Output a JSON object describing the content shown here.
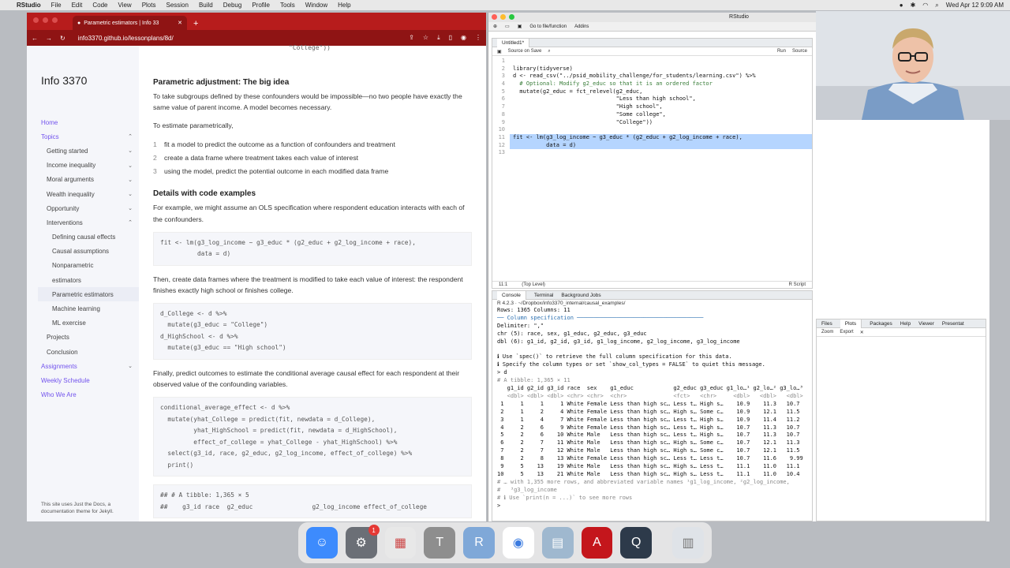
{
  "menubar": {
    "app_name": "RStudio",
    "items": [
      "File",
      "Edit",
      "Code",
      "View",
      "Plots",
      "Session",
      "Build",
      "Debug",
      "Profile",
      "Tools",
      "Window",
      "Help"
    ],
    "clock": "Wed Apr 12  9:09 AM"
  },
  "browser": {
    "tab_title": "Parametric estimators | Info 33",
    "url": "info3370.github.io/lessonplans/8d/",
    "site_title": "Info 3370",
    "nav": [
      {
        "label": "Home",
        "level": 0,
        "link": true
      },
      {
        "label": "Topics",
        "level": 0,
        "link": true,
        "chevron": "⌃"
      },
      {
        "label": "Getting started",
        "level": 1,
        "chevron": "⌄"
      },
      {
        "label": "Income inequality",
        "level": 1,
        "chevron": "⌄"
      },
      {
        "label": "Moral arguments",
        "level": 1,
        "chevron": "⌄"
      },
      {
        "label": "Wealth inequality",
        "level": 1,
        "chevron": "⌄"
      },
      {
        "label": "Opportunity",
        "level": 1,
        "chevron": "⌄"
      },
      {
        "label": "Interventions",
        "level": 1,
        "chevron": "⌃"
      },
      {
        "label": "Defining causal effects",
        "level": 2
      },
      {
        "label": "Causal assumptions",
        "level": 2
      },
      {
        "label": "Nonparametric",
        "level": 2
      },
      {
        "label": "estimators",
        "level": 2
      },
      {
        "label": "Parametric estimators",
        "level": 2,
        "active": true
      },
      {
        "label": "Machine learning",
        "level": 2
      },
      {
        "label": "ML exercise",
        "level": 2
      },
      {
        "label": "Projects",
        "level": 1
      },
      {
        "label": "Conclusion",
        "level": 1
      },
      {
        "label": "Assignments",
        "level": 0,
        "link": true,
        "chevron": "⌄"
      },
      {
        "label": "Weekly Schedule",
        "level": 0,
        "link": true
      },
      {
        "label": "Who We Are",
        "level": 0,
        "link": true
      }
    ],
    "footer": "This site uses Just the Docs, a documentation theme for Jekyll.",
    "content": {
      "top_code": "\"College\"))",
      "h1": "Parametric adjustment: The big idea",
      "p1": "To take subgroups defined by these confounders would be impossible—no two people have exactly the same value of parent income. A model becomes necessary.",
      "p2": "To estimate parametrically,",
      "steps": [
        "fit a model to predict the outcome as a function of confounders and treatment",
        "create a data frame where treatment takes each value of interest",
        "using the model, predict the potential outcome in each modified data frame"
      ],
      "h2": "Details with code examples",
      "p3": "For example, we might assume an OLS specification where respondent education interacts with each of the confounders.",
      "code1": "fit <- lm(g3_log_income ~ g3_educ * (g2_educ + g2_log_income + race),\n          data = d)",
      "p4": "Then, create data frames where the treatment is modified to take each value of interest: the respondent finishes exactly high school or finishes college.",
      "code2": "d_College <- d %>%\n  mutate(g3_educ = \"College\")\nd_HighSchool <- d %>%\n  mutate(g3_educ == \"High school\")",
      "p5": "Finally, predict outcomes to estimate the conditional average causal effect for each respondent at their observed value of the confounding variables.",
      "code3": "conditional_average_effect <- d %>%\n  mutate(yhat_College = predict(fit, newdata = d_College),\n         yhat_HighSchool = predict(fit, newdata = d_HighSchool),\n         effect_of_college = yhat_College - yhat_HighSchool) %>%\n  select(g3_id, race, g2_educ, g2_log_income, effect_of_college) %>%\n  print()",
      "code4": "## # A tibble: 1,365 × 5\n##    g3_id race  g2_educ                g2_log_income effect_of_college"
    }
  },
  "rstudio": {
    "window_title": "RStudio",
    "toolbar": {
      "goto": "Go to file/function",
      "addins": "Addins"
    },
    "editor": {
      "tab": "Untitled1*",
      "source_on_save": "Source on Save",
      "run": "Run",
      "source": "Source",
      "lines": [
        "",
        "library(tidyverse)",
        "d <- read_csv(\"../psid_mobility_challenge/for_students/learning.csv\") %>%",
        "  # Optional: Modify g2_educ so that it is an ordered factor",
        "  mutate(g2_educ = fct_relevel(g2_educ,",
        "                               \"Less than high school\",",
        "                               \"High school\",",
        "                               \"Some college\",",
        "                               \"College\"))",
        "",
        "fit <- lm(g3_log_income ~ g3_educ * (g2_educ + g2_log_income + race),",
        "          data = d)",
        ""
      ],
      "status_pos": "11:1",
      "status_scope": "(Top Level)",
      "status_type": "R Script"
    },
    "console": {
      "tabs": [
        "Console",
        "Terminal",
        "Background Jobs"
      ],
      "path": "R 4.2.3 · ~/Dropbox/info3370_internal/causal_examples/",
      "lines": [
        "Rows: 1365 Columns: 11",
        "── Column specification ──────────────────────────────────────",
        "Delimiter: \",\"",
        "chr (5): race, sex, g1_educ, g2_educ, g3_educ",
        "dbl (6): g1_id, g2_id, g3_id, g1_log_income, g2_log_income, g3_log_income",
        "",
        "ℹ Use `spec()` to retrieve the full column specification for this data.",
        "ℹ Specify the column types or set `show_col_types = FALSE` to quiet this message.",
        "> d",
        "# A tibble: 1,365 × 11",
        "   g1_id g2_id g3_id race  sex    g1_educ            g2_educ g3_educ g1_lo…¹ g2_lo…² g3_lo…³",
        "   <dbl> <dbl> <dbl> <chr> <chr>  <chr>              <fct>   <chr>     <dbl>   <dbl>   <dbl>",
        " 1     1     1     1 White Female Less than high sc… Less t… High s…    10.9    11.3   10.7",
        " 2     1     2     4 White Female Less than high sc… High s… Some c…    10.9    12.1   11.5",
        " 3     1     4     7 White Female Less than high sc… Less t… High s…    10.9    11.4   11.2",
        " 4     2     6     9 White Female Less than high sc… Less t… High s…    10.7    11.3   10.7",
        " 5     2     6    10 White Male   Less than high sc… Less t… High s…    10.7    11.3   10.7",
        " 6     2     7    11 White Male   Less than high sc… High s… Some c…    10.7    12.1   11.3",
        " 7     2     7    12 White Male   Less than high sc… High s… Some c…    10.7    12.1   11.5",
        " 8     2     8    13 White Female Less than high sc… Less t… Less t…    10.7    11.6    9.99",
        " 9     5    13    19 White Male   Less than high sc… High s… Less t…    11.1    11.0   11.1",
        "10     5    13    21 White Male   Less than high sc… High s… Less t…    11.1    11.0   10.4",
        "# … with 1,355 more rows, and abbreviated variable names ¹g1_log_income, ²g2_log_income,",
        "#   ³g3_log_income",
        "# ℹ Use `print(n = ...)` to see more rows",
        ">"
      ]
    },
    "files_pane": {
      "tabs": [
        "Files",
        "Plots",
        "Packages",
        "Help",
        "Viewer",
        "Presentat"
      ],
      "zoom": "Zoom",
      "export": "Export"
    }
  },
  "dock": {
    "badge_count": "1",
    "apps": [
      "finder",
      "system-settings",
      "launchpad",
      "texshop",
      "r-app",
      "chrome",
      "preview",
      "acrobat",
      "quicktime",
      "trash"
    ]
  }
}
